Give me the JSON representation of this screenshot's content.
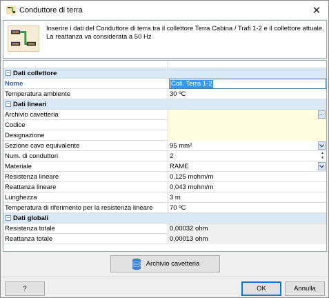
{
  "window": {
    "title": "Conduttore di terra",
    "close_glyph": "✕"
  },
  "header": {
    "line1": "Inserire i dati del Conduttore di terra tra il collettore Terra Cabina / Trafi 1-2 e il collettore attuale.",
    "line2": "La reattanza va considerata a 50 Hz"
  },
  "grid": {
    "sections": [
      {
        "title": "Dati collettore",
        "rows": [
          {
            "label": "Nome",
            "value": "Coll. Terra 1-2"
          },
          {
            "label": "Temperatura ambiente",
            "value": "30 ºC"
          }
        ]
      },
      {
        "title": "Dati lineari",
        "rows": [
          {
            "label": "Archivio cavetteria",
            "value": ""
          },
          {
            "label": "Codice",
            "value": ""
          },
          {
            "label": "Designazione",
            "value": ""
          },
          {
            "label": "Sezione cavo equivalente",
            "value": "95 mm²"
          },
          {
            "label": "Num. di conduttori",
            "value": "2"
          },
          {
            "label": "Materiale",
            "value": "RAME"
          },
          {
            "label": "Resistenza lineare",
            "value": "0,125 mohm/m"
          },
          {
            "label": "Reattanza lineare",
            "value": "0,043 mohm/m"
          },
          {
            "label": "Lunghezza",
            "value": "3 m"
          },
          {
            "label": "Temperatura di riferimento per la resistenza lineare",
            "value": "70 ºC"
          }
        ]
      },
      {
        "title": "Dati globali",
        "rows": [
          {
            "label": "Resistenza totale",
            "value": "0,00032 ohm"
          },
          {
            "label": "Reattanza totale",
            "value": "0,00013 ohm"
          }
        ]
      }
    ]
  },
  "buttons": {
    "archivio": "Archivio cavetteria",
    "help": "?",
    "ok": "OK",
    "cancel": "Annulla"
  },
  "icons": {
    "title": "electrical-ground-icon",
    "header": "ground-conductor-icon",
    "archive": "database-icon",
    "dropdown": "chevron-down-icon",
    "browse": "ellipsis-icon",
    "spin": "spinner-icon"
  }
}
